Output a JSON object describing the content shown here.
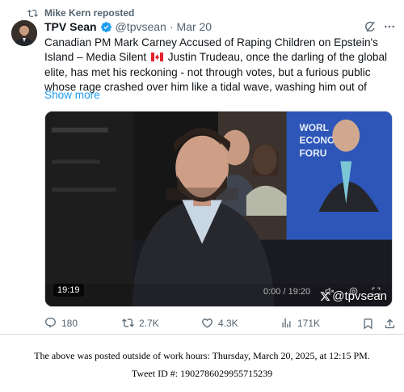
{
  "repost": {
    "label": "Mike Kern reposted",
    "icon": "repost-icon"
  },
  "author": {
    "display_name": "TPV Sean",
    "handle": "@tpvsean",
    "separator": "·",
    "timestamp": "Mar 20",
    "verified": true,
    "verified_color": "#1d9bf0"
  },
  "tweet": {
    "text_before_flag": "Canadian PM Mark Carney Accused of Raping Children on Epstein's Island – Media Silent ",
    "text_after_flag": " Justin Trudeau, once the darling of the global elite, has met his reckoning - not through votes, but a furious public whose rage crashed over him like a tidal wave, washing him out of",
    "show_more": "Show more"
  },
  "media": {
    "duration": "19:19",
    "time_readout": "0:00 / 19:20",
    "watermark": "@tpvsean",
    "backdrop_text": [
      "WORL",
      "ECONO",
      "FORU"
    ]
  },
  "actions": {
    "replies": "180",
    "reposts": "2.7K",
    "likes": "4.3K",
    "views": "171K"
  },
  "colors": {
    "secondary_text": "#536471",
    "accent": "#1d9bf0",
    "border": "#cfd9de"
  },
  "footer": {
    "posted_note": "The above was posted outside of work hours: Thursday, March 20, 2025, at 12:15 PM.",
    "tweet_id": "Tweet ID #: 1902786029955715239"
  }
}
